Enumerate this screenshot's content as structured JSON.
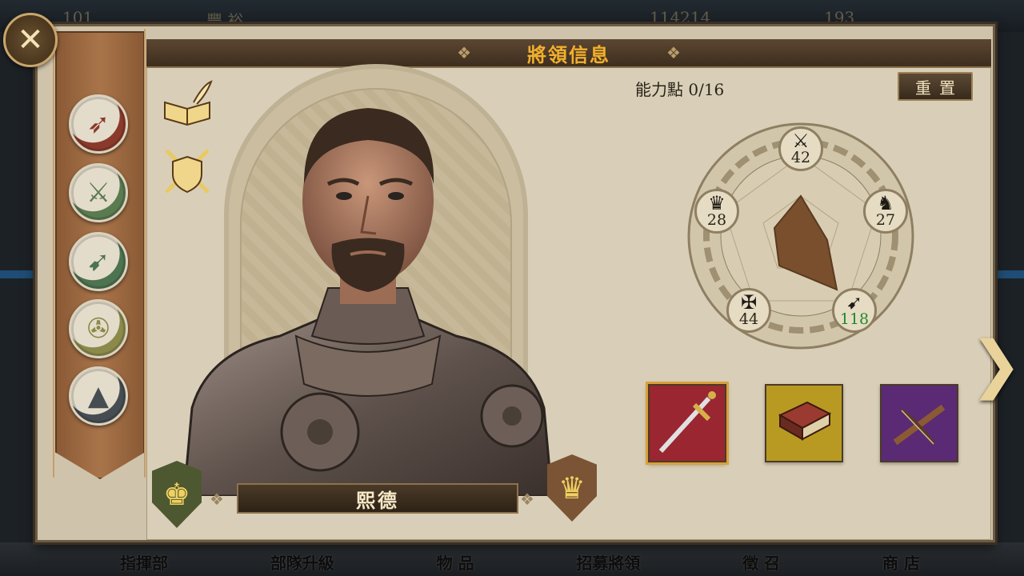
{
  "background": {
    "resources": [
      "101",
      "豐 裕",
      "114214",
      "193"
    ],
    "bottom_nav": [
      "指揮部",
      "部隊升級",
      "物 品",
      "招募將領",
      "徵 召",
      "商 店"
    ]
  },
  "panel": {
    "title": "將領信息",
    "close_icon": "close-icon"
  },
  "unit_types": [
    {
      "name": "spear",
      "color": "#8a3a2b",
      "glyph": "➶"
    },
    {
      "name": "swordsman",
      "color": "#5a7a4f",
      "glyph": "⚔"
    },
    {
      "name": "archer",
      "color": "#4d7350",
      "glyph": "➹"
    },
    {
      "name": "crossbow",
      "color": "#8b8a4a",
      "glyph": "✇"
    },
    {
      "name": "terrain",
      "color": "#464d52",
      "glyph": "▲"
    }
  ],
  "general": {
    "name": "熙德",
    "left_shield_color": "#4e5830",
    "right_shield_color": "#7a5434"
  },
  "abilities": {
    "points_label": "能力點 0/16",
    "reset_label": "重置",
    "stats": [
      {
        "icon": "swords-icon",
        "value": "42",
        "color": "#2b2418"
      },
      {
        "icon": "horse-icon",
        "value": "27",
        "color": "#2b2418"
      },
      {
        "icon": "bow-icon",
        "value": "118",
        "color": "#1f8a2a"
      },
      {
        "icon": "eagle-icon",
        "value": "44",
        "color": "#2b2418"
      },
      {
        "icon": "crown-icon",
        "value": "28",
        "color": "#2b2418"
      }
    ]
  },
  "equipment": [
    {
      "name": "sword",
      "bg": "#9a2631"
    },
    {
      "name": "tome",
      "bg": "#b89a22"
    },
    {
      "name": "crossbow",
      "bg": "#5a2a74"
    }
  ]
}
